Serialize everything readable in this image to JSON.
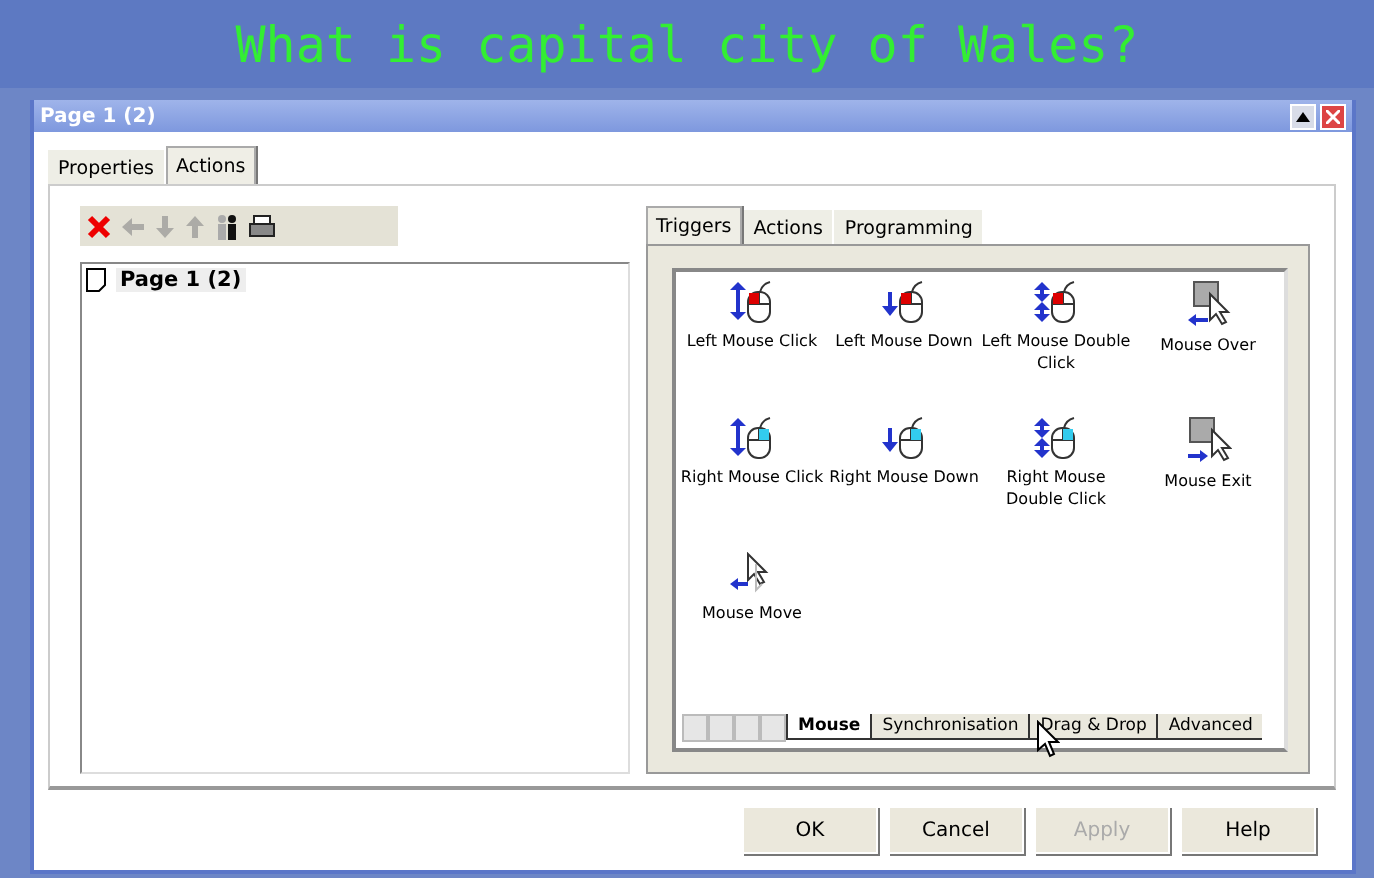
{
  "banner": {
    "question": "What is capital city of Wales?"
  },
  "window": {
    "title": "Page 1 (2)"
  },
  "tabs": [
    {
      "label": "Properties",
      "selected": false
    },
    {
      "label": "Actions",
      "selected": true
    }
  ],
  "toolbar": [
    {
      "kind": "delete",
      "disabled": false
    },
    {
      "kind": "left",
      "disabled": true
    },
    {
      "kind": "down",
      "disabled": true
    },
    {
      "kind": "up",
      "disabled": true
    },
    {
      "kind": "people",
      "disabled": false
    },
    {
      "kind": "print",
      "disabled": false
    }
  ],
  "tree": {
    "items": [
      {
        "label": "Page 1 (2)",
        "selected": true
      }
    ]
  },
  "event_tabs": [
    {
      "label": "Triggers",
      "selected": true
    },
    {
      "label": "Actions",
      "selected": false
    },
    {
      "label": "Programming",
      "selected": false
    }
  ],
  "triggers": [
    {
      "label": "Left Mouse Click",
      "kind": "left_click"
    },
    {
      "label": "Left Mouse Down",
      "kind": "left_down"
    },
    {
      "label": "Left Mouse Double Click",
      "kind": "left_double"
    },
    {
      "label": "Mouse Over",
      "kind": "over"
    },
    {
      "label": "Right Mouse Click",
      "kind": "right_click"
    },
    {
      "label": "Right Mouse Down",
      "kind": "right_down"
    },
    {
      "label": "Right Mouse Double Click",
      "kind": "right_double"
    },
    {
      "label": "Mouse Exit",
      "kind": "exit"
    },
    {
      "label": "Mouse Move",
      "kind": "move"
    }
  ],
  "category_tabs": [
    {
      "label": "Mouse",
      "selected": true
    },
    {
      "label": "Synchronisation",
      "selected": false
    },
    {
      "label": "Drag & Drop",
      "selected": false
    },
    {
      "label": "Advanced",
      "selected": false
    }
  ],
  "buttons": [
    {
      "label": "OK",
      "disabled": false
    },
    {
      "label": "Cancel",
      "disabled": false
    },
    {
      "label": "Apply",
      "disabled": true
    },
    {
      "label": "Help",
      "disabled": false
    }
  ]
}
